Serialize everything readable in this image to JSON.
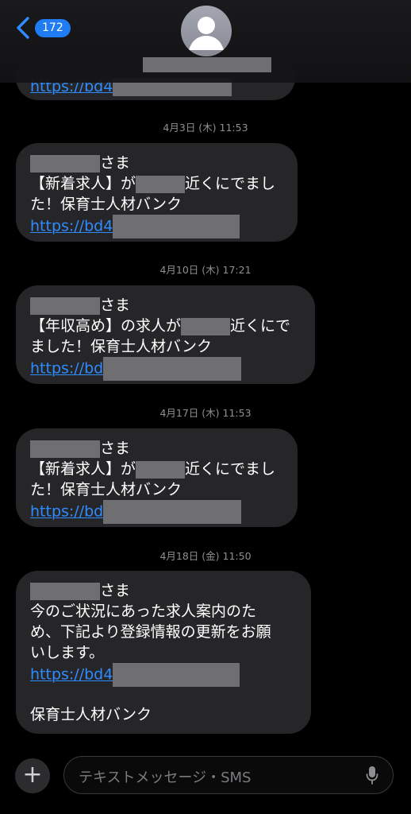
{
  "header": {
    "unread_count": "172"
  },
  "messages": [
    {
      "link": "https://bd4"
    },
    {
      "line1": "さま",
      "line2_a": "【新着求人】が",
      "line2_b": "近くにでまし",
      "line3": "た！保育士人材バンク",
      "link": "https://bd4"
    },
    {
      "line1": "さま",
      "line2_a": "【年収高め】の求人が",
      "line2_b": "近くにで",
      "line3": "ました！保育士人材バンク",
      "link": "https://bd"
    },
    {
      "line1": "さま",
      "line2_a": "【新着求人】が",
      "line2_b": "近くにでまし",
      "line3": "た！保育士人材バンク",
      "link": "https://bd"
    },
    {
      "line1": "さま",
      "line2": "今のご状況にあった求人案内のた",
      "line3": "め、下記より登録情報の更新をお願",
      "line4": "いします。",
      "link": "https://bd4",
      "footer": "保育士人材バンク"
    }
  ],
  "timestamps": [
    "4月3日 (木) 11:53",
    "4月10日 (木) 17:21",
    "4月17日 (木) 11:53",
    "4月18日 (金) 11:50"
  ],
  "input": {
    "placeholder": "テキストメッセージ・SMS",
    "plus": "+"
  },
  "icons": {
    "back": "chevron-left",
    "avatar": "person",
    "mic": "microphone",
    "add": "plus"
  },
  "colors": {
    "bubble": "#262629",
    "link": "#2f8cff",
    "badge": "#1f7cf3"
  }
}
